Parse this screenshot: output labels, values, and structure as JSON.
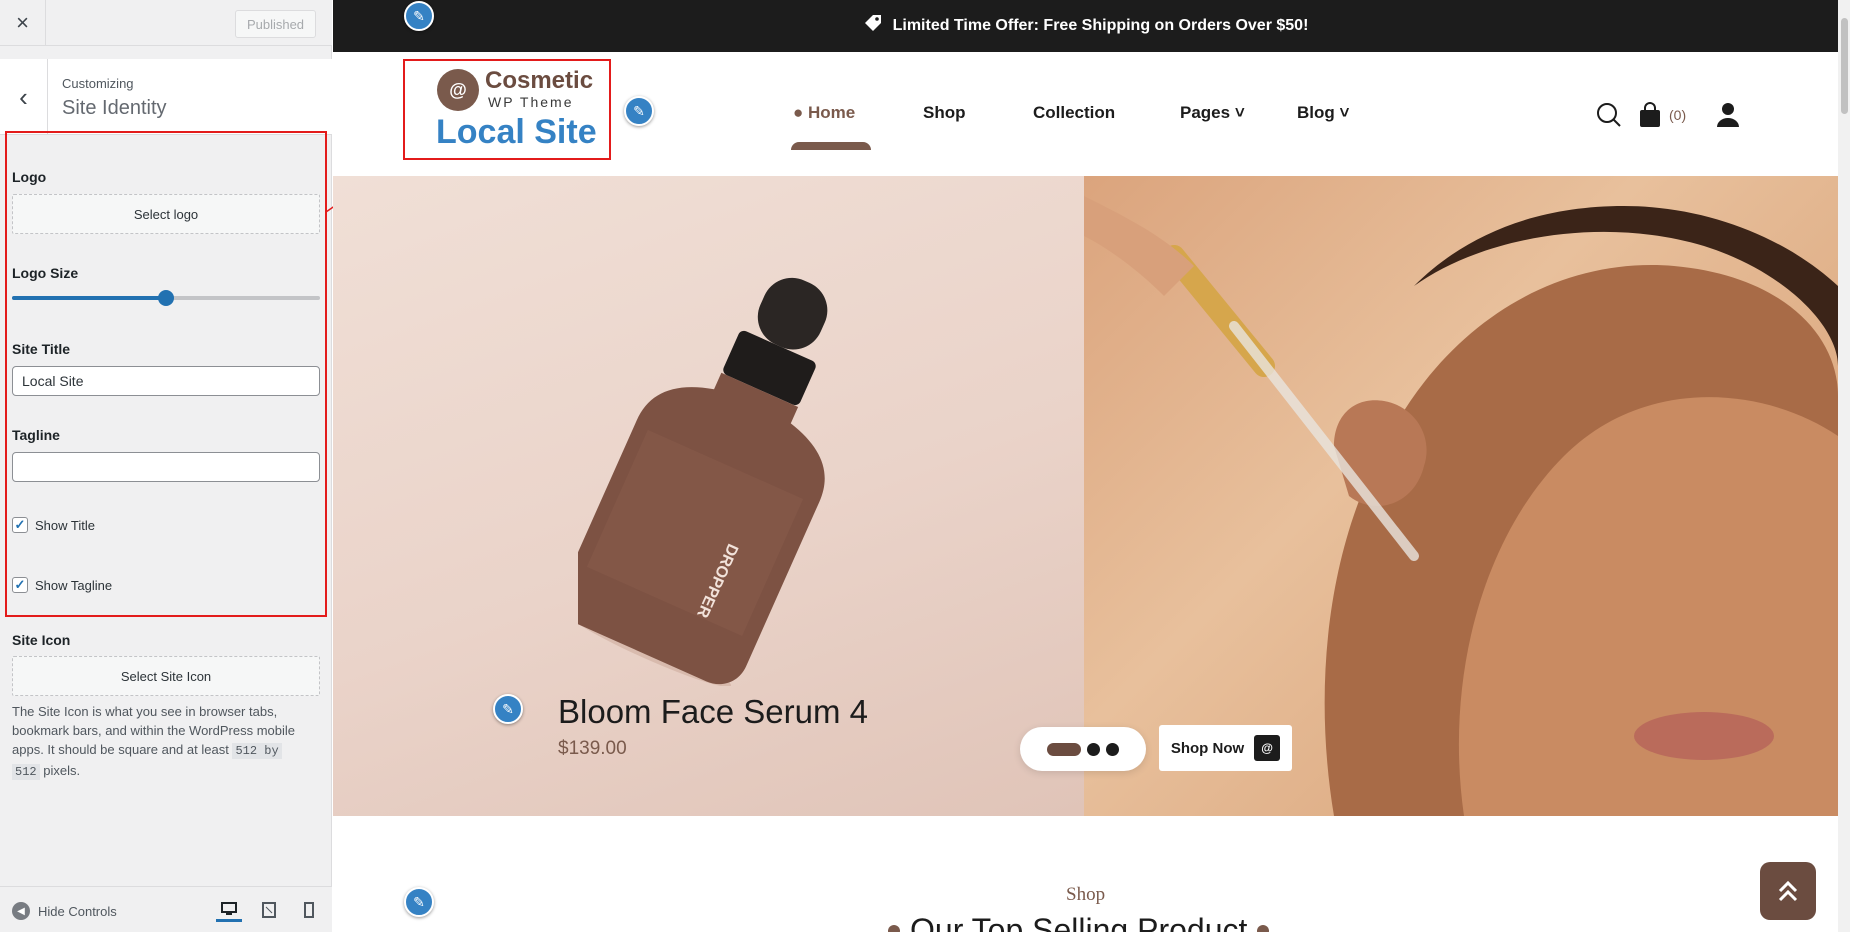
{
  "customizer": {
    "close_icon": "×",
    "publish_label": "Published",
    "back_icon": "‹",
    "customizing_label": "Customizing",
    "section_title": "Site Identity",
    "logo": {
      "label": "Logo",
      "button": "Select logo"
    },
    "logo_size": {
      "label": "Logo Size",
      "value_fraction": 0.5
    },
    "site_title": {
      "label": "Site Title",
      "value": "Local Site"
    },
    "tagline": {
      "label": "Tagline",
      "value": ""
    },
    "show_title": {
      "label": "Show Title",
      "checked": true
    },
    "show_tagline": {
      "label": "Show Tagline",
      "checked": true
    },
    "site_icon": {
      "label": "Site Icon",
      "button": "Select Site Icon",
      "help_pre": "The Site Icon is what you see in browser tabs, bookmark bars, and within the WordPress mobile apps. It should be square and at least",
      "help_code1": "512 by",
      "help_code2": "512",
      "help_post": "pixels."
    },
    "hide_controls": "Hide Controls",
    "accent_color": "#2271b1",
    "highlight_color": "#e31b1b"
  },
  "preview": {
    "announcement": "Limited Time Offer: Free Shipping on Orders Over $50!",
    "logo": {
      "name": "Cosmetic",
      "sub": "WP Theme",
      "mark": "@"
    },
    "site_title": "Local Site",
    "nav": {
      "home": "Home",
      "shop": "Shop",
      "collection": "Collection",
      "pages": "Pages",
      "blog": "Blog"
    },
    "cart_count": "(0)",
    "hero": {
      "product_name": "Bloom Face Serum 4",
      "product_price": "$139.00",
      "shop_now": "Shop Now"
    },
    "section": {
      "subtitle": "Shop",
      "heading": "Our Top Selling Product"
    },
    "brand_color": "#7a5a4c"
  }
}
